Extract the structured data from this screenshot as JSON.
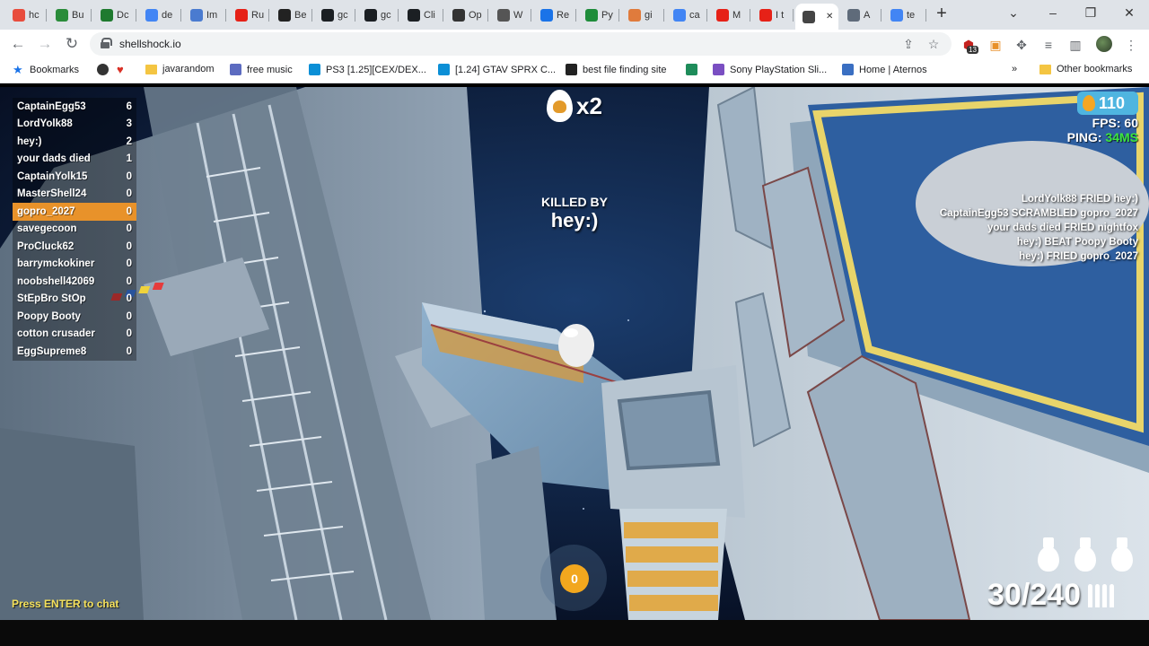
{
  "tabs": [
    {
      "label": "hc",
      "color": "#e84d3d"
    },
    {
      "label": "Bu",
      "color": "#2a8c3a"
    },
    {
      "label": "Dc",
      "color": "#1f7a2f"
    },
    {
      "label": "de",
      "color": "#4285f4"
    },
    {
      "label": "Im",
      "color": "#4a7bd0"
    },
    {
      "label": "Ru",
      "color": "#e62117"
    },
    {
      "label": "Be",
      "color": "#222222"
    },
    {
      "label": "gc",
      "color": "#1b1f23"
    },
    {
      "label": "gc",
      "color": "#1b1f23"
    },
    {
      "label": "Cli",
      "color": "#1b1f23"
    },
    {
      "label": "Op",
      "color": "#333333"
    },
    {
      "label": "W",
      "color": "#555555"
    },
    {
      "label": "Re",
      "color": "#1a73e8"
    },
    {
      "label": "Py",
      "color": "#1e8c3a"
    },
    {
      "label": "gi",
      "color": "#e07b3c"
    },
    {
      "label": "ca",
      "color": "#4285f4"
    },
    {
      "label": "M",
      "color": "#e62117"
    },
    {
      "label": "I t",
      "color": "#e62117"
    },
    {
      "label": "",
      "color": "#444444"
    },
    {
      "label": "A",
      "color": "#5f6b7a"
    },
    {
      "label": "te",
      "color": "#4285f4"
    }
  ],
  "url": "shellshock.io",
  "extension_badge": "13",
  "bookmarks": [
    {
      "label": "Bookmarks",
      "color": "#1a73e8"
    },
    {
      "label": "",
      "color": "#333333"
    },
    {
      "label": "",
      "color": "#d93025"
    },
    {
      "label": "javarandom",
      "color": "#f4c542"
    },
    {
      "label": "free music",
      "color": "#5c6bc0"
    },
    {
      "label": "PS3 [1.25][CEX/DEX...",
      "color": "#0b8fd6"
    },
    {
      "label": "[1.24] GTAV SPRX C...",
      "color": "#0b8fd6"
    },
    {
      "label": "best file finding site",
      "color": "#222222"
    },
    {
      "label": "",
      "color": "#1e8c5a"
    },
    {
      "label": "Sony PlayStation Sli...",
      "color": "#7a4fc2"
    },
    {
      "label": "Home | Aternos",
      "color": "#3a6fc2"
    }
  ],
  "other_bookmarks": "Other bookmarks",
  "scoreboard": [
    {
      "name": "CaptainEgg53",
      "score": "6",
      "me": false
    },
    {
      "name": "LordYolk88",
      "score": "3",
      "me": false
    },
    {
      "name": "hey:)",
      "score": "2",
      "me": false
    },
    {
      "name": "your dads died",
      "score": "1",
      "me": false
    },
    {
      "name": "CaptainYolk15",
      "score": "0",
      "me": false
    },
    {
      "name": "MasterShell24",
      "score": "0",
      "me": false
    },
    {
      "name": "gopro_2027",
      "score": "0",
      "me": true
    },
    {
      "name": "savegecoon",
      "score": "0",
      "me": false
    },
    {
      "name": "ProCluck62",
      "score": "0",
      "me": false
    },
    {
      "name": "barrymckokiner",
      "score": "0",
      "me": false
    },
    {
      "name": "noobshell42069",
      "score": "0",
      "me": false
    },
    {
      "name": "StEpBro StOp",
      "score": "0",
      "me": false
    },
    {
      "name": "Poopy Booty",
      "score": "0",
      "me": false
    },
    {
      "name": "cotton crusader",
      "score": "0",
      "me": false
    },
    {
      "name": "EggSupreme8",
      "score": "0",
      "me": false
    }
  ],
  "killstreak": "x2",
  "killed_by_label": "KILLED BY",
  "killed_by_name": "hey:)",
  "eggs": "110",
  "fps_label": "FPS: 60",
  "ping_label": "PING: ",
  "ping_value": "34MS",
  "killfeed": [
    "LordYolk88 FRIED hey:)",
    "CaptainEgg53 SCRAMBLED gopro_2027",
    "your dads died FRIED nightfox",
    "hey:) BEAT Poopy Booty",
    "hey:) FRIED gopro_2027"
  ],
  "chat_prompt": "Press ENTER to chat",
  "grenade_count": "0",
  "ammo": "30/240",
  "colors": {
    "accent_orange": "#e8922a",
    "ping_green": "#3de63d",
    "egg_blue": "#4fb5e0"
  }
}
